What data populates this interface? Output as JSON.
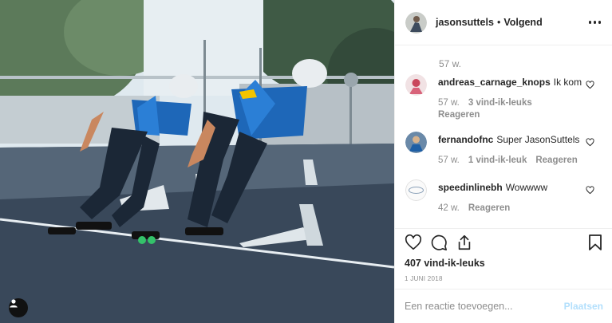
{
  "header": {
    "username": "jasonsuttels",
    "separator": "•",
    "follow_label": "Volgend"
  },
  "comments": {
    "top_meta": "57 w.",
    "items": [
      {
        "username": "andreas_carnage_knops",
        "text": "Ik kom",
        "time": "57 w.",
        "likes": "3 vind-ik-leuks",
        "reply": "Reageren"
      },
      {
        "username": "fernandofnc",
        "text": "Super JasonSuttels",
        "time": "57 w.",
        "likes": "1 vind-ik-leuk",
        "reply": "Reageren"
      },
      {
        "username": "speedinlinebh",
        "text": "Wowwww",
        "time": "42 w.",
        "likes": "",
        "reply": "Reageren"
      }
    ]
  },
  "actions": {
    "likes": "407 vind-ik-leuks",
    "date": "1 JUNI 2018"
  },
  "add_comment": {
    "placeholder": "Een reactie toevoegen...",
    "post_label": "Plaatsen"
  },
  "colors": {
    "post_button": "#b2dffc",
    "meta": "#8e8e8e",
    "text": "#262626"
  },
  "icons": [
    "heart-icon",
    "comment-icon",
    "share-icon",
    "bookmark-icon",
    "more-icon",
    "user-tag-icon"
  ]
}
